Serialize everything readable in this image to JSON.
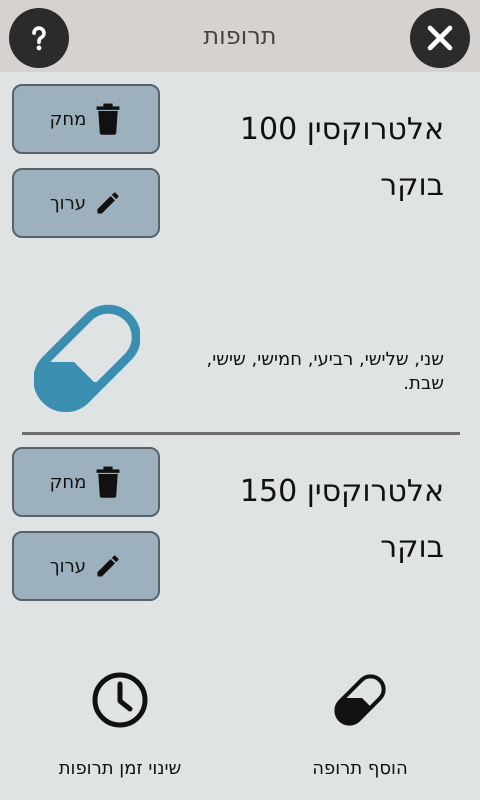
{
  "header": {
    "title": "תרופות",
    "help_icon": "question-mark-icon",
    "close_icon": "close-icon"
  },
  "medications": [
    {
      "name": "אלטרוקסין 100",
      "time": "בוקר",
      "days": "שני, שלישי, רביעי, חמישי, שישי, שבת.",
      "delete_label": "מחק",
      "edit_label": "ערוך"
    },
    {
      "name": "אלטרוקסין 150",
      "time": "בוקר",
      "delete_label": "מחק",
      "edit_label": "ערוך"
    }
  ],
  "bottom_bar": {
    "change_time_label": "שינוי זמן תרופות",
    "add_medication_label": "הוסף תרופה"
  },
  "colors": {
    "background": "#dfe3e4",
    "header": "#d6d2cf",
    "button": "#9db0bd",
    "pill_accent": "#3a8fb0"
  }
}
